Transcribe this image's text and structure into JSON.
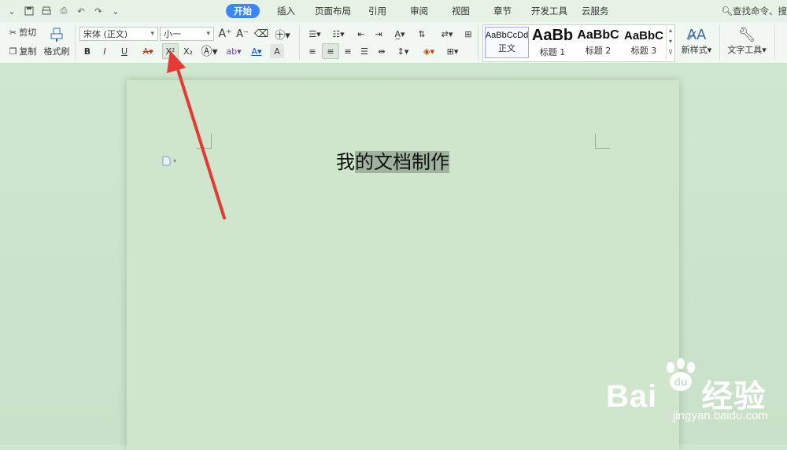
{
  "menubar": {
    "tabs": [
      {
        "label": "开始",
        "active": true
      },
      {
        "label": "插入"
      },
      {
        "label": "页面布局"
      },
      {
        "label": "引用"
      },
      {
        "label": "审阅"
      },
      {
        "label": "视图"
      },
      {
        "label": "章节"
      },
      {
        "label": "开发工具"
      },
      {
        "label": "云服务"
      }
    ],
    "search_label": "查找命令、搜"
  },
  "ribbon": {
    "clipboard": {
      "cut": "剪切",
      "copy": "复制",
      "format_painter": "格式刷"
    },
    "font": {
      "family": "宋体 (正文)",
      "size": "小一",
      "bold": "B",
      "italic": "I",
      "underline": "U",
      "superscript": "X²",
      "subscript": "X₂"
    },
    "styles": [
      {
        "preview": "AaBbCcDd",
        "name": "正文"
      },
      {
        "preview": "AaBb",
        "name": "标题 1"
      },
      {
        "preview": "AaBbC",
        "name": "标题 2"
      },
      {
        "preview": "AaBbC",
        "name": "标题 3"
      }
    ],
    "new_style": "新样式",
    "text_tools": "文字工具"
  },
  "document": {
    "text_plain": "我",
    "text_selected": "的文档制作 "
  },
  "watermark": {
    "brand": "Bai",
    "brand2": "经验",
    "url": "jingyan.baidu.com"
  },
  "colors": {
    "accent": "#3a86ff",
    "page": "#cfe6cd",
    "selection": "#9fb39f",
    "arrow": "#e53935"
  }
}
